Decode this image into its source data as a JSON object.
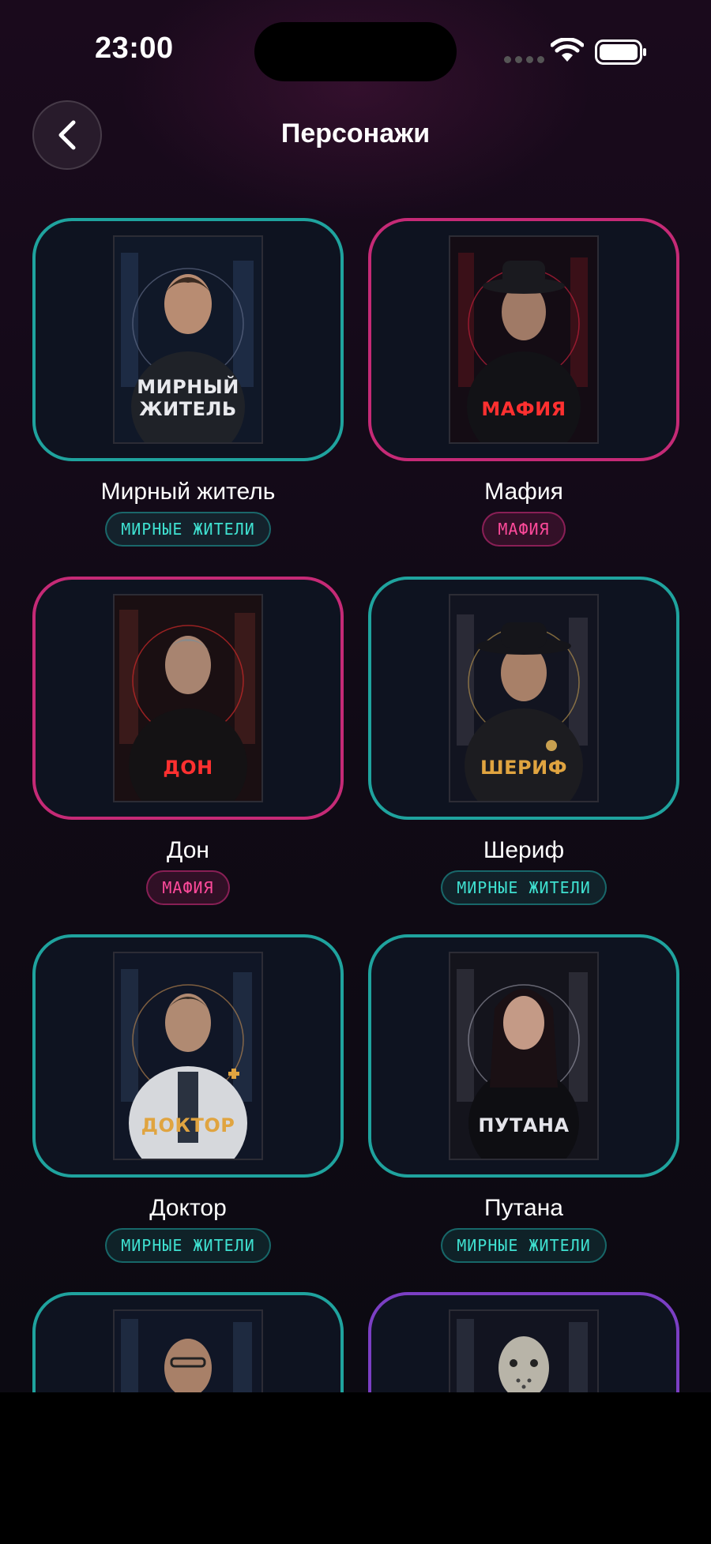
{
  "status": {
    "time": "23:00"
  },
  "header": {
    "title": "Персонажи",
    "back_icon": "chevron-left-icon"
  },
  "colors": {
    "civilian": "#1fa39e",
    "mafia": "#c52a76",
    "maniac": "#7b3fc4",
    "sheriff_gold": "#d8a24a",
    "doctor_gold": "#d79a3c"
  },
  "characters": [
    {
      "name": "Мирный житель",
      "card_label": "МИРНЫЙ ЖИТЕЛЬ",
      "team": "МИРНЫЕ ЖИТЕЛИ"
    },
    {
      "name": "Мафия",
      "card_label": "МАФИЯ",
      "team": "МАФИЯ"
    },
    {
      "name": "Дон",
      "card_label": "ДОН",
      "team": "МАФИЯ"
    },
    {
      "name": "Шериф",
      "card_label": "ШЕРИФ",
      "team": "МИРНЫЕ ЖИТЕЛИ"
    },
    {
      "name": "Доктор",
      "card_label": "ДОКТОР",
      "team": "МИРНЫЕ ЖИТЕЛИ"
    },
    {
      "name": "Путана",
      "card_label": "ПУТАНА",
      "team": "МИРНЫЕ ЖИТЕЛИ"
    }
  ]
}
